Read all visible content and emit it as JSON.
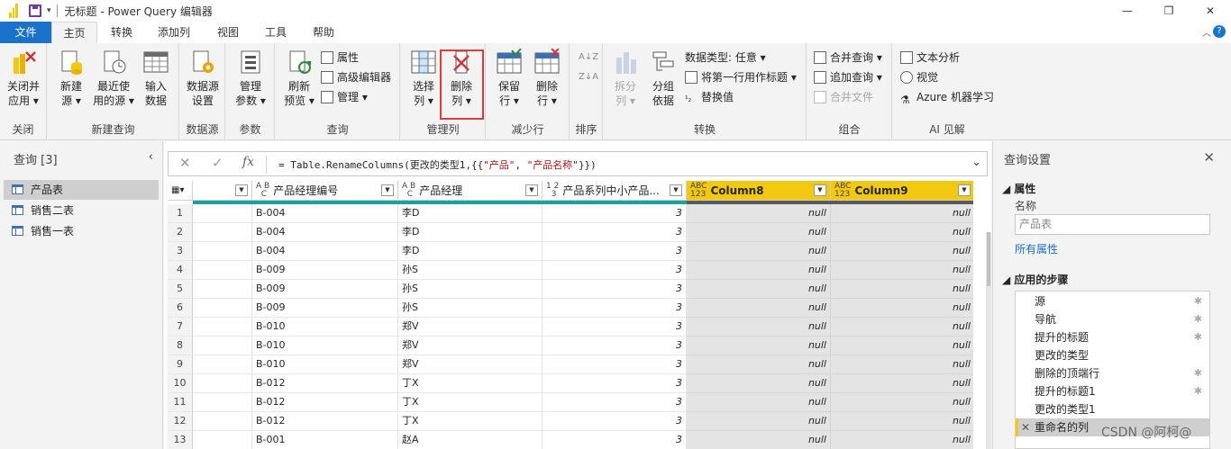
{
  "window": {
    "title": "无标题 - Power Query 编辑器",
    "minimize": "—",
    "restore": "❐",
    "close": "✕"
  },
  "tabs": [
    "文件",
    "主页",
    "转换",
    "添加列",
    "视图",
    "工具",
    "帮助"
  ],
  "active_tab": "主页",
  "ribbon": {
    "close_group": {
      "label": "关闭",
      "close_apply": [
        "关闭并",
        "应用 ▾"
      ]
    },
    "new_query_group": {
      "label": "新建查询",
      "new_source": [
        "新建",
        "源 ▾"
      ],
      "recent_sources": [
        "最近使",
        "用的源 ▾"
      ],
      "enter_data": [
        "输入",
        "数据"
      ]
    },
    "datasource_group": {
      "label": "数据源",
      "settings": [
        "数据源",
        "设置"
      ]
    },
    "params_group": {
      "label": "参数",
      "manage_params": [
        "管理",
        "参数 ▾"
      ]
    },
    "query_group": {
      "label": "查询",
      "refresh": [
        "刷新",
        "预览 ▾"
      ],
      "properties": "属性",
      "advanced_editor": "高级编辑器",
      "manage": "管理 ▾"
    },
    "manage_cols_group": {
      "label": "管理列",
      "choose_cols": [
        "选择",
        "列 ▾"
      ],
      "remove_cols": [
        "删除",
        "列 ▾"
      ]
    },
    "reduce_rows_group": {
      "label": "减少行",
      "keep_rows": [
        "保留",
        "行 ▾"
      ],
      "remove_rows": [
        "删除",
        "行 ▾"
      ]
    },
    "sort_group": {
      "label": "排序",
      "asc": "A↓Z",
      "desc": "Z↓A"
    },
    "transform_group": {
      "label": "转换",
      "split_col": [
        "拆分",
        "列 ▾"
      ],
      "group_by": [
        "分组",
        "依据"
      ],
      "data_type": "数据类型: 任意 ▾",
      "first_row_header": "将第一行用作标题 ▾",
      "replace_values": "替换值"
    },
    "combine_group": {
      "label": "组合",
      "merge_queries": "合并查询 ▾",
      "append_queries": "追加查询 ▾",
      "combine_files": "合并文件"
    },
    "ai_group": {
      "label": "AI 见解",
      "text_analytics": "文本分析",
      "vision": "视觉",
      "azure_ml": "Azure 机器学习"
    }
  },
  "queries": {
    "title": "查询 [3]",
    "collapse": "‹",
    "items": [
      "产品表",
      "销售二表",
      "销售一表"
    ],
    "selected": 0
  },
  "formula_bar": {
    "cancel": "✕",
    "commit": "✓",
    "fx": "fx",
    "prefix": "= Table.RenameColumns(更改的类型1,{{",
    "s1": "\"产品\"",
    "mid": ", ",
    "s2": "\"产品名称\"",
    "suffix": "}})",
    "expand": "⌄"
  },
  "grid": {
    "columns": [
      {
        "name": "",
        "type": "",
        "kind": "plain"
      },
      {
        "name": "产品经理编号",
        "type": "A B\n  C",
        "kind": "text"
      },
      {
        "name": "产品经理",
        "type": "A B\n  C",
        "kind": "text"
      },
      {
        "name": "产品系列中小产品...",
        "type": "1 2\n  3",
        "kind": "num"
      },
      {
        "name": "Column8",
        "type": "ABC\n123",
        "kind": "any"
      },
      {
        "name": "Column9",
        "type": "ABC\n123",
        "kind": "any"
      }
    ],
    "rows": [
      [
        "1",
        "",
        "B-004",
        "李D",
        "3",
        "null",
        "null"
      ],
      [
        "2",
        "",
        "B-004",
        "李D",
        "3",
        "null",
        "null"
      ],
      [
        "3",
        "",
        "B-004",
        "李D",
        "3",
        "null",
        "null"
      ],
      [
        "4",
        "",
        "B-009",
        "孙S",
        "3",
        "null",
        "null"
      ],
      [
        "5",
        "",
        "B-009",
        "孙S",
        "3",
        "null",
        "null"
      ],
      [
        "6",
        "",
        "B-009",
        "孙S",
        "3",
        "null",
        "null"
      ],
      [
        "7",
        "",
        "B-010",
        "郑V",
        "3",
        "null",
        "null"
      ],
      [
        "8",
        "",
        "B-010",
        "郑V",
        "3",
        "null",
        "null"
      ],
      [
        "9",
        "",
        "B-010",
        "郑V",
        "3",
        "null",
        "null"
      ],
      [
        "10",
        "",
        "B-012",
        "丁X",
        "3",
        "null",
        "null"
      ],
      [
        "11",
        "",
        "B-012",
        "丁X",
        "3",
        "null",
        "null"
      ],
      [
        "12",
        "",
        "B-012",
        "丁X",
        "3",
        "null",
        "null"
      ],
      [
        "13",
        "",
        "B-001",
        "赵A",
        "3",
        "null",
        "null"
      ]
    ]
  },
  "settings": {
    "title": "查询设置",
    "close": "✕",
    "properties_header": "◢ 属性",
    "name_label": "名称",
    "name_value": "产品表",
    "all_properties": "所有属性",
    "steps_header": "◢ 应用的步骤",
    "steps": [
      {
        "name": "源",
        "gear": true
      },
      {
        "name": "导航",
        "gear": true
      },
      {
        "name": "提升的标题",
        "gear": true
      },
      {
        "name": "更改的类型",
        "gear": false
      },
      {
        "name": "删除的顶端行",
        "gear": true
      },
      {
        "name": "提升的标题1",
        "gear": true
      },
      {
        "name": "更改的类型1",
        "gear": false
      },
      {
        "name": "重命名的列",
        "gear": false
      }
    ],
    "selected_step": 7
  },
  "watermark": "CSDN @阿柯@",
  "colors": {
    "accent": "#1a73c9",
    "selected_column": "#f2c811",
    "highlight_box": "#e03a3a",
    "quality_bar": "#1aa39b"
  }
}
